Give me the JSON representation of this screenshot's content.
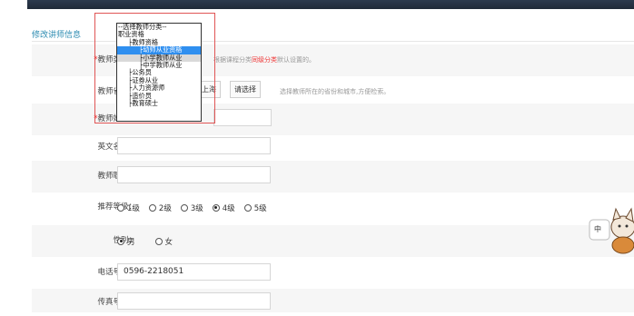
{
  "section_title": "修改讲师信息",
  "form": {
    "type": {
      "label": "教师类型：",
      "required": "*",
      "hint_prefix": "根据课程分类",
      "hint_link": "同级分类",
      "hint_suffix": "默认设置的。"
    },
    "region": {
      "label": "教师省市：",
      "province": "上海",
      "choose_button": "请选择",
      "hint": "选择教师所在的省份和城市,方便检索。"
    },
    "name": {
      "label": "教师姓名：",
      "required": "*",
      "value": ""
    },
    "english_name": {
      "label": "英文名称：",
      "value": ""
    },
    "title": {
      "label": "教师职称：",
      "value": ""
    },
    "level": {
      "label": "推荐等级：",
      "options": [
        "1级",
        "2级",
        "3级",
        "4级",
        "5级"
      ],
      "selected": "4级"
    },
    "gender": {
      "label": "性别：",
      "options": [
        "男",
        "女"
      ],
      "selected": "男"
    },
    "phone": {
      "label": "电话号码：",
      "value": "0596-2218051"
    },
    "fax": {
      "label": "传真号码：",
      "value": ""
    }
  },
  "dropdown": {
    "items": [
      "--选择教师分类--",
      "职业资格",
      "  ├教师资格",
      "      ├幼师从业资格",
      "      ├小学教师从业",
      "      ├中学教师从业",
      "  ├公务员",
      "  ├证券从业",
      "  ├人力资源师",
      "  ├造价员",
      "  ├教育硕士"
    ],
    "selected_index": 3,
    "highlight_index": 4
  },
  "mascot": {
    "bubble_text": "中",
    "icon": "cat-mascot-icon"
  }
}
